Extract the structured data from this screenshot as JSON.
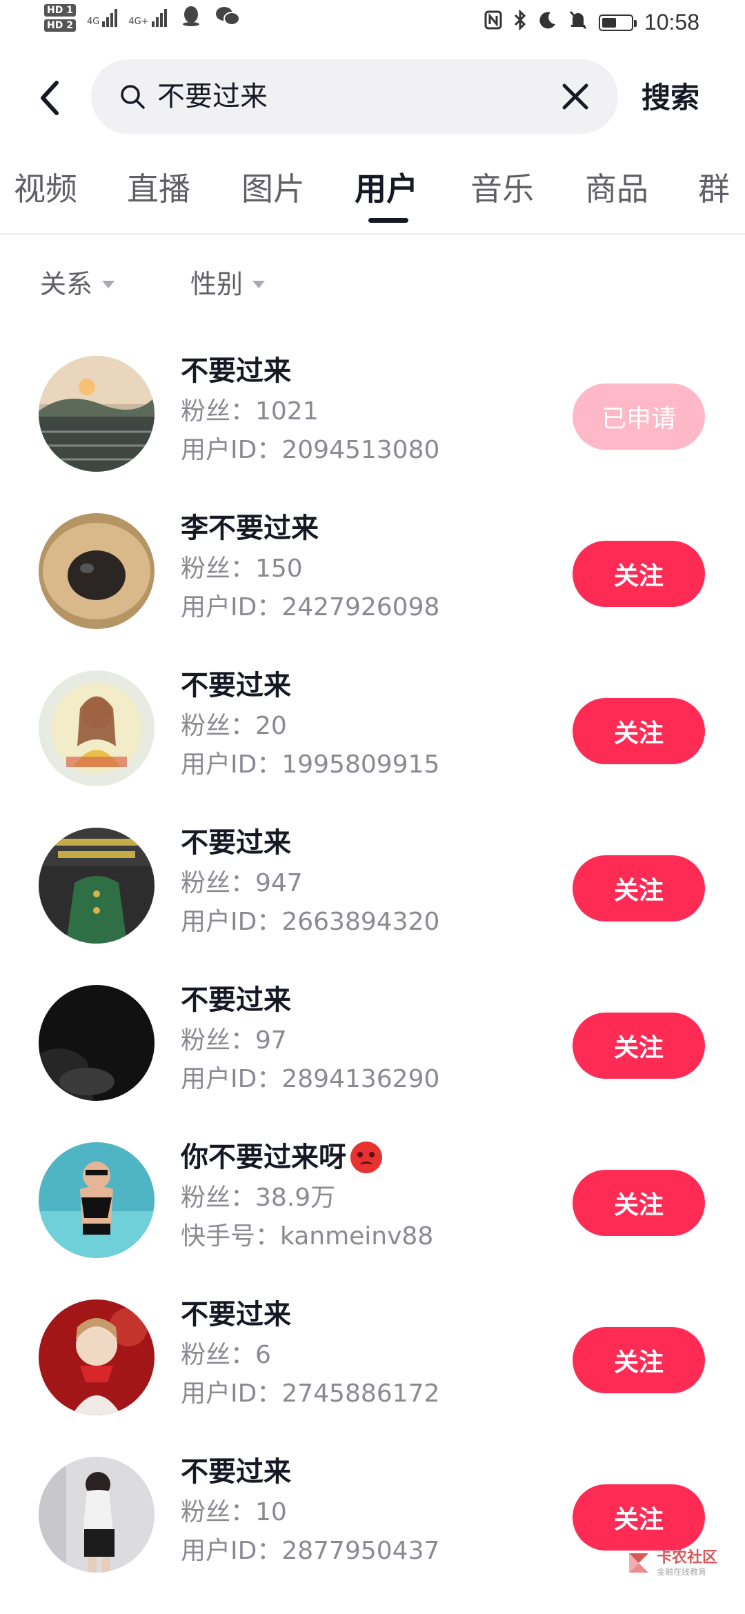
{
  "status_bar": {
    "sim1": "HD 1",
    "sim2": "HD 2",
    "net1": "4G",
    "net2": "4G+",
    "time": "10:58",
    "battery_level": 0.5
  },
  "search": {
    "query": "不要过来",
    "submit_label": "搜索"
  },
  "tabs": [
    {
      "label": "视频",
      "active": false
    },
    {
      "label": "直播",
      "active": false
    },
    {
      "label": "图片",
      "active": false
    },
    {
      "label": "用户",
      "active": true
    },
    {
      "label": "音乐",
      "active": false
    },
    {
      "label": "商品",
      "active": false
    },
    {
      "label": "群",
      "active": false
    }
  ],
  "filters": [
    {
      "label": "关系"
    },
    {
      "label": "性别"
    }
  ],
  "colors": {
    "accent": "#fe2c55",
    "accent_disabled": "#ffb8c7",
    "text_primary": "#161823",
    "text_secondary": "#8a8a92"
  },
  "users": [
    {
      "name": "不要过来",
      "fans": "粉丝：1021",
      "id_line": "用户ID：2094513080",
      "button": "已申请",
      "applied": true
    },
    {
      "name": "李不要过来",
      "fans": "粉丝：150",
      "id_line": "用户ID：2427926098",
      "button": "关注",
      "applied": false
    },
    {
      "name": "不要过来",
      "fans": "粉丝：20",
      "id_line": "用户ID：1995809915",
      "button": "关注",
      "applied": false
    },
    {
      "name": "不要过来",
      "fans": "粉丝：947",
      "id_line": "用户ID：2663894320",
      "button": "关注",
      "applied": false
    },
    {
      "name": "不要过来",
      "fans": "粉丝：97",
      "id_line": "用户ID：2894136290",
      "button": "关注",
      "applied": false
    },
    {
      "name": "你不要过来呀",
      "fans": "粉丝：38.9万",
      "id_line": "快手号：kanmeinv88",
      "button": "关注",
      "applied": false,
      "emoji": "angry-face-icon"
    },
    {
      "name": "不要过来",
      "fans": "粉丝：6",
      "id_line": "用户ID：2745886172",
      "button": "关注",
      "applied": false
    },
    {
      "name": "不要过来",
      "fans": "粉丝：10",
      "id_line": "用户ID：2877950437",
      "button": "关注",
      "applied": false
    }
  ],
  "watermark": {
    "title": "卡农社区",
    "subtitle": "金融在线教育"
  }
}
